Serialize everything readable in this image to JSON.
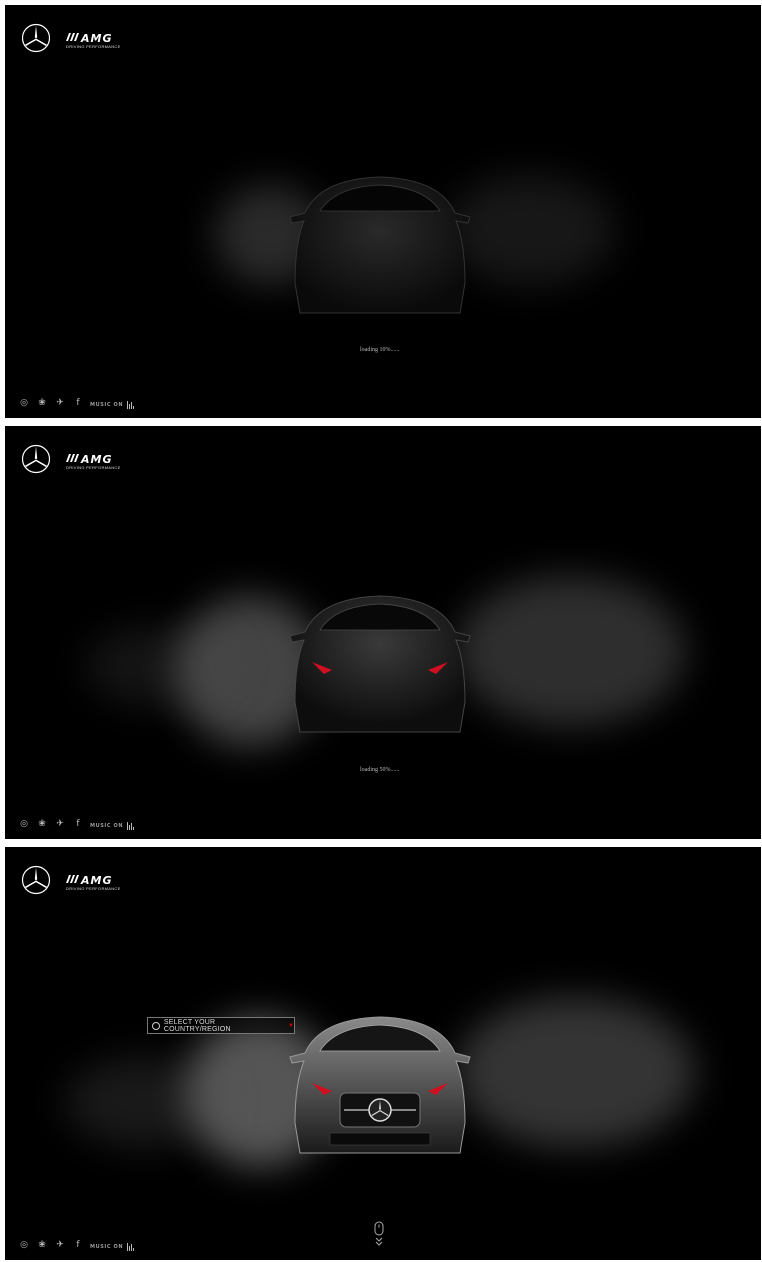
{
  "brand": {
    "amg_text": "AMG",
    "amg_tagline": "DRIVING PERFORMANCE"
  },
  "panels": [
    {
      "loading_text": "loading 10%......",
      "progress": 0.1
    },
    {
      "loading_text": "loading 50%......",
      "progress": 0.5
    },
    {
      "loading_text": "",
      "progress": 1.0
    }
  ],
  "footer": {
    "music_label": "MUSIC ON",
    "social_icons": [
      "weibo-icon",
      "wechat-icon",
      "twitter-icon",
      "facebook-icon"
    ]
  },
  "region": {
    "label": "SELECT YOUR  COUNTRY/REGION"
  },
  "colors": {
    "background": "#000000",
    "accent": "#cc0000",
    "text": "#dddddd"
  }
}
